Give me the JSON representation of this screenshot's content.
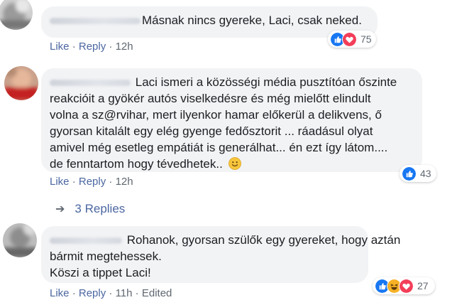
{
  "comments": [
    {
      "lines": [
        "Másnak nincs gyereke, Laci, csak neked."
      ],
      "actions": {
        "like": "Like",
        "reply": "Reply",
        "time": "12h"
      },
      "reactions": {
        "icons": [
          "like-icon",
          "love-icon"
        ],
        "count": "75"
      }
    },
    {
      "lines": [
        "Laci ismeri a közösségi média pusztítóan őszinte",
        "reakcióit a gyökér autós viselkedésre és még mielőtt elindult",
        "volna a sz@rvihar, mert ilyenkor hamar előkerül a delikvens, ő",
        "gyorsan kitalált egy elég gyenge fedősztorit ... ráadásul olyat",
        "amivel még esetleg empátiát is generálhat... én ezt így látom....",
        "de fenntartom hogy tévedhetek.."
      ],
      "emoji": "smile-emoji",
      "actions": {
        "like": "Like",
        "reply": "Reply",
        "time": "12h"
      },
      "reactions": {
        "icons": [
          "like-icon"
        ],
        "count": "43"
      },
      "replies": "3 Replies"
    },
    {
      "lines": [
        "Rohanok, gyorsan szülők egy gyereket, hogy aztán",
        "bármit megtehessek.",
        "Köszi a tippet Laci!"
      ],
      "actions": {
        "like": "Like",
        "reply": "Reply",
        "time": "11h",
        "edited": "Edited"
      },
      "reactions": {
        "icons": [
          "like-icon",
          "haha-icon",
          "love-icon"
        ],
        "count": "27"
      }
    }
  ],
  "colors": {
    "link": "#4b67a1",
    "bubble": "#f2f3f5",
    "like": "#1877f2",
    "love": "#f33e58",
    "haha": "#f7b125"
  }
}
